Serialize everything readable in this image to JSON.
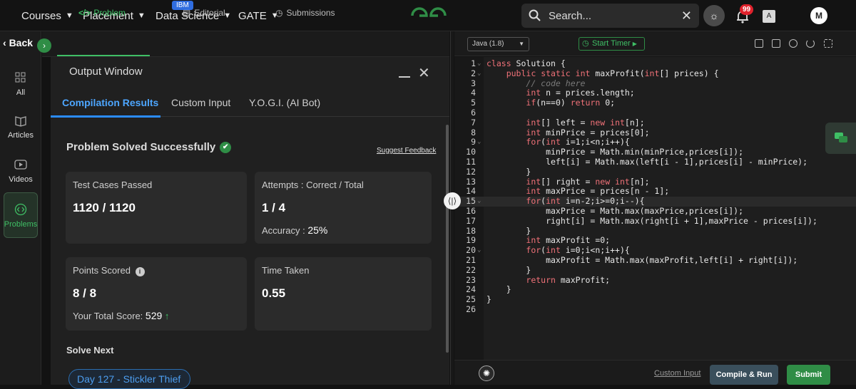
{
  "topnav": {
    "courses": "Courses",
    "placement": "Placement",
    "data_science": "Data Science",
    "ibm_badge": "IBM",
    "gate": "GATE",
    "search_placeholder": "Search...",
    "notification_count": "99",
    "avatar_initial": "M"
  },
  "sidebar": {
    "back": "Back",
    "items": [
      {
        "label": "All",
        "icon": "grid-icon"
      },
      {
        "label": "Articles",
        "icon": "book-icon"
      },
      {
        "label": "Videos",
        "icon": "play-icon"
      },
      {
        "label": "Problems",
        "icon": "code-icon"
      }
    ]
  },
  "tabs": {
    "problem": "Problem",
    "editorial": "Editorial",
    "submissions": "Submissions"
  },
  "output": {
    "title": "Output Window",
    "subtabs": [
      "Compilation Results",
      "Custom Input",
      "Y.O.G.I. (AI Bot)"
    ],
    "status": "Problem Solved Successfully",
    "feedback": "Suggest Feedback",
    "cards": {
      "testcases_label": "Test Cases Passed",
      "testcases_value": "1120 / 1120",
      "attempts_label": "Attempts : Correct / Total",
      "attempts_value": "1 / 4",
      "accuracy_label": "Accuracy :",
      "accuracy_value": "25%",
      "points_label": "Points Scored",
      "points_value": "8 / 8",
      "total_label": "Your Total Score:",
      "total_value": "529",
      "time_label": "Time Taken",
      "time_value": "0.55"
    },
    "solve_next": "Solve Next",
    "next_problem": "Day 127 - Stickler Thief"
  },
  "editor": {
    "language": "Java (1.8)",
    "timer": "Start Timer",
    "custom_input": "Custom Input",
    "compile_run": "Compile & Run",
    "submit": "Submit",
    "lines": [
      "class Solution {",
      "    public static int maxProfit(int[] prices) {",
      "        // code here",
      "        int n = prices.length;",
      "        if(n==0) return 0;",
      "",
      "        int[] left = new int[n];",
      "        int minPrice = prices[0];",
      "        for(int i=1;i<n;i++){",
      "            minPrice = Math.min(minPrice,prices[i]);",
      "            left[i] = Math.max(left[i - 1],prices[i] - minPrice);",
      "        }",
      "        int[] right = new int[n];",
      "        int maxPrice = prices[n - 1];",
      "        for(int i=n-2;i>=0;i--){",
      "            maxPrice = Math.max(maxPrice,prices[i]);",
      "            right[i] = Math.max(right[i + 1],maxPrice - prices[i]);",
      "        }",
      "        int maxProfit =0;",
      "        for(int i=0;i<n;i++){",
      "            maxProfit = Math.max(maxProfit,left[i] + right[i]);",
      "        }",
      "        return maxProfit;",
      "    }",
      "}",
      ""
    ]
  },
  "colors": {
    "accent_green": "#2f8d46",
    "link_blue": "#2b8cff",
    "badge_red": "#e0222c"
  }
}
